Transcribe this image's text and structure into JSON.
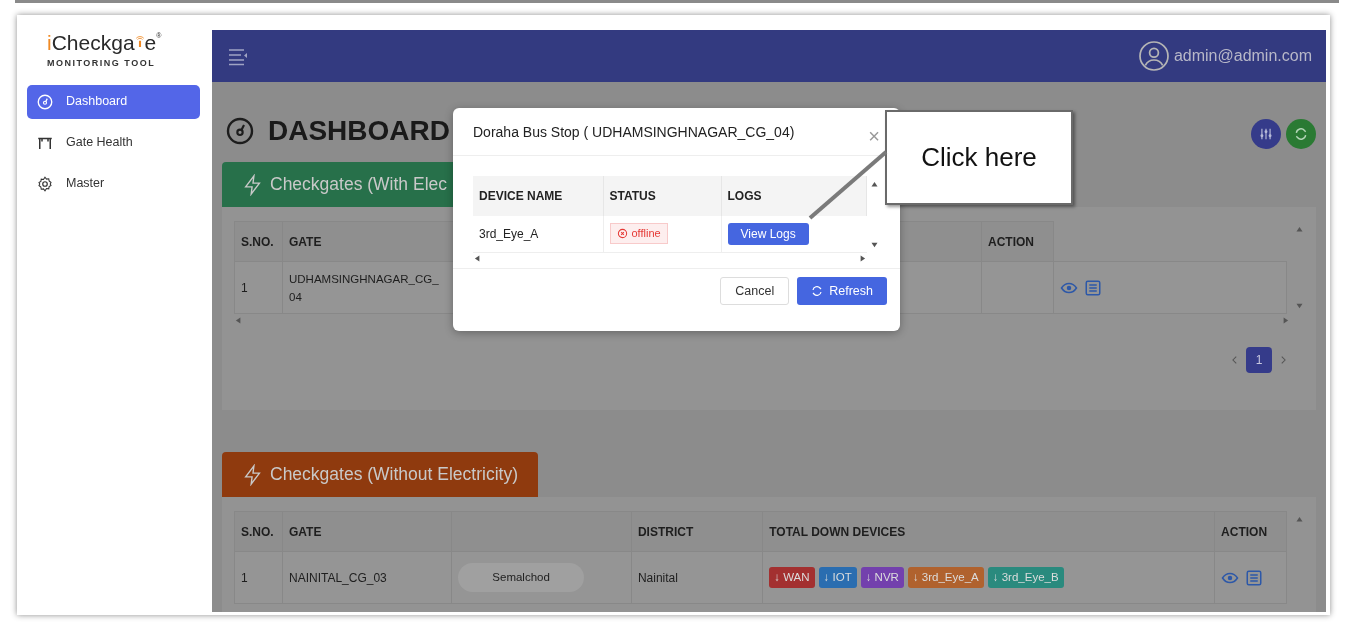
{
  "logo": {
    "initial": "i",
    "word": "Checkga",
    "ending": "e",
    "registered": "®",
    "subtitle": "MONITORING TOOL"
  },
  "sidebar": {
    "items": [
      {
        "label": "Dashboard",
        "selected": true
      },
      {
        "label": "Gate Health",
        "selected": false
      },
      {
        "label": "Master",
        "selected": false
      }
    ]
  },
  "header": {
    "user": "admin@admin.com"
  },
  "page": {
    "title": "DASHBOARD"
  },
  "sections": [
    {
      "title": "Checkgates (With Elec",
      "color": "#27704a",
      "columns": [
        "S.NO.",
        "GATE",
        "ACTION"
      ],
      "rows": [
        {
          "cells": [
            "1",
            "UDHAMSINGHNAGAR_CG_04"
          ]
        }
      ],
      "pagination": {
        "pages": [
          {
            "label": "1",
            "selected": true
          }
        ]
      }
    },
    {
      "title": "Checkgates (Without Electricity)",
      "color": "#8f3a0e",
      "columns": [
        "S.NO.",
        "GATE",
        "",
        "DISTRICT",
        "TOTAL DOWN DEVICES",
        "ACTION"
      ],
      "rows": [
        {
          "cells": [
            "1",
            "NAINITAL_CG_03"
          ],
          "area": "Semalchod",
          "district": "Nainital",
          "devices": [
            {
              "label": "↓ WAN",
              "color": "#a33030"
            },
            {
              "label": "↓ IOT",
              "color": "#2a6db0"
            },
            {
              "label": "↓ NVR",
              "color": "#7340ad"
            },
            {
              "label": "↓ 3rd_Eye_A",
              "color": "#b0622e"
            },
            {
              "label": "↓ 3rd_Eye_B",
              "color": "#2a8a7e"
            }
          ]
        }
      ]
    }
  ],
  "modal": {
    "title": "Doraha Bus Stop ( UDHAMSINGHNAGAR_CG_04)",
    "close": "×",
    "columns": [
      "DEVICE NAME",
      "STATUS",
      "LOGS"
    ],
    "rows": [
      {
        "device": "3rd_Eye_A",
        "status": "offline",
        "action": "View Logs"
      }
    ],
    "buttons": [
      {
        "label": "Cancel",
        "kind": "secondary"
      },
      {
        "label": "Refresh",
        "kind": "primary"
      }
    ]
  },
  "callout": {
    "text": "Click here"
  }
}
